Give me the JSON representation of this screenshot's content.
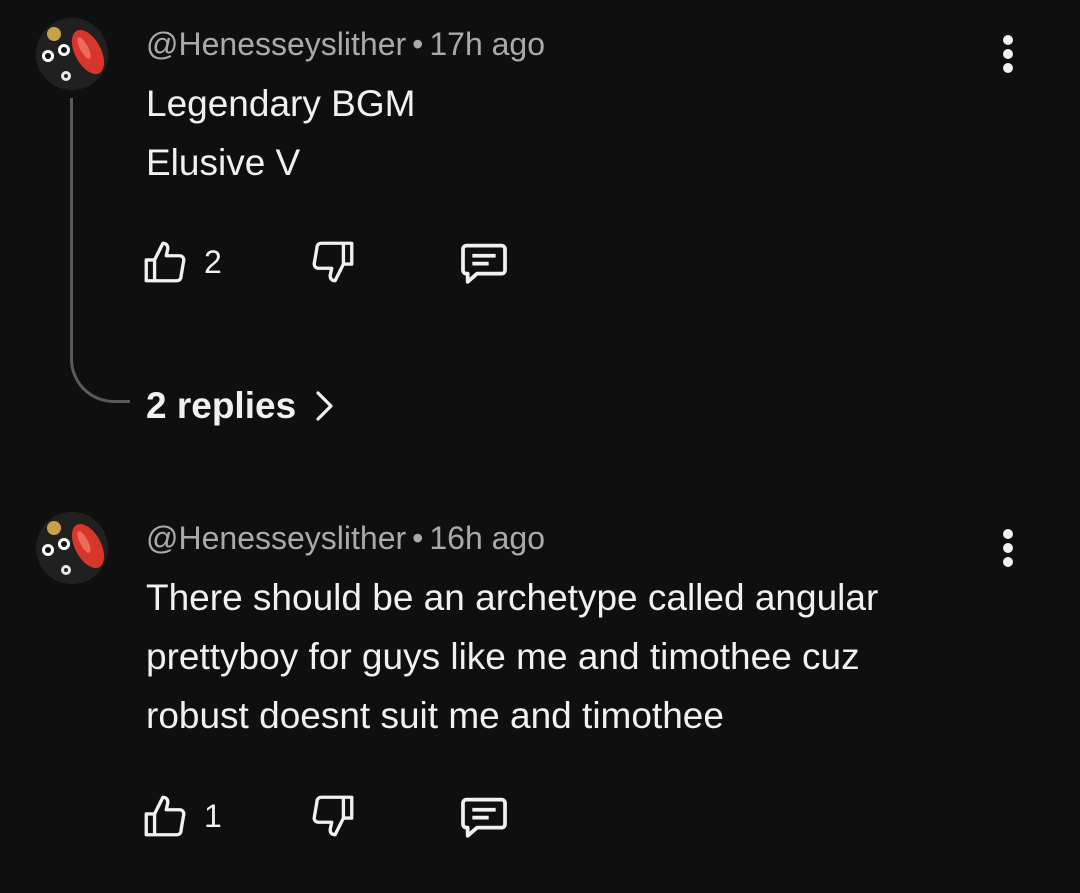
{
  "comments": [
    {
      "author": "@Henesseyslither",
      "separator": "•",
      "time": "17h ago",
      "lines": [
        "Legendary BGM",
        "Elusive V"
      ],
      "like_count": "2",
      "replies_label": "2 replies"
    },
    {
      "author": "@Henesseyslither",
      "separator": "•",
      "time": "16h ago",
      "lines": [
        "There should be an archetype called angular",
        "prettyboy for guys like me and timothee cuz",
        "robust doesnt suit me and timothee"
      ],
      "like_count": "1"
    }
  ],
  "icons": {
    "like": "thumbs-up-icon",
    "dislike": "thumbs-down-icon",
    "reply": "reply-comment-icon",
    "more": "more-vertical-icon",
    "expand": "chevron-right-icon"
  },
  "colors": {
    "background": "#0f0f0f",
    "text": "#f1f1f1",
    "meta_text": "#aaaaaa",
    "thread_line": "#5a5a5a"
  }
}
